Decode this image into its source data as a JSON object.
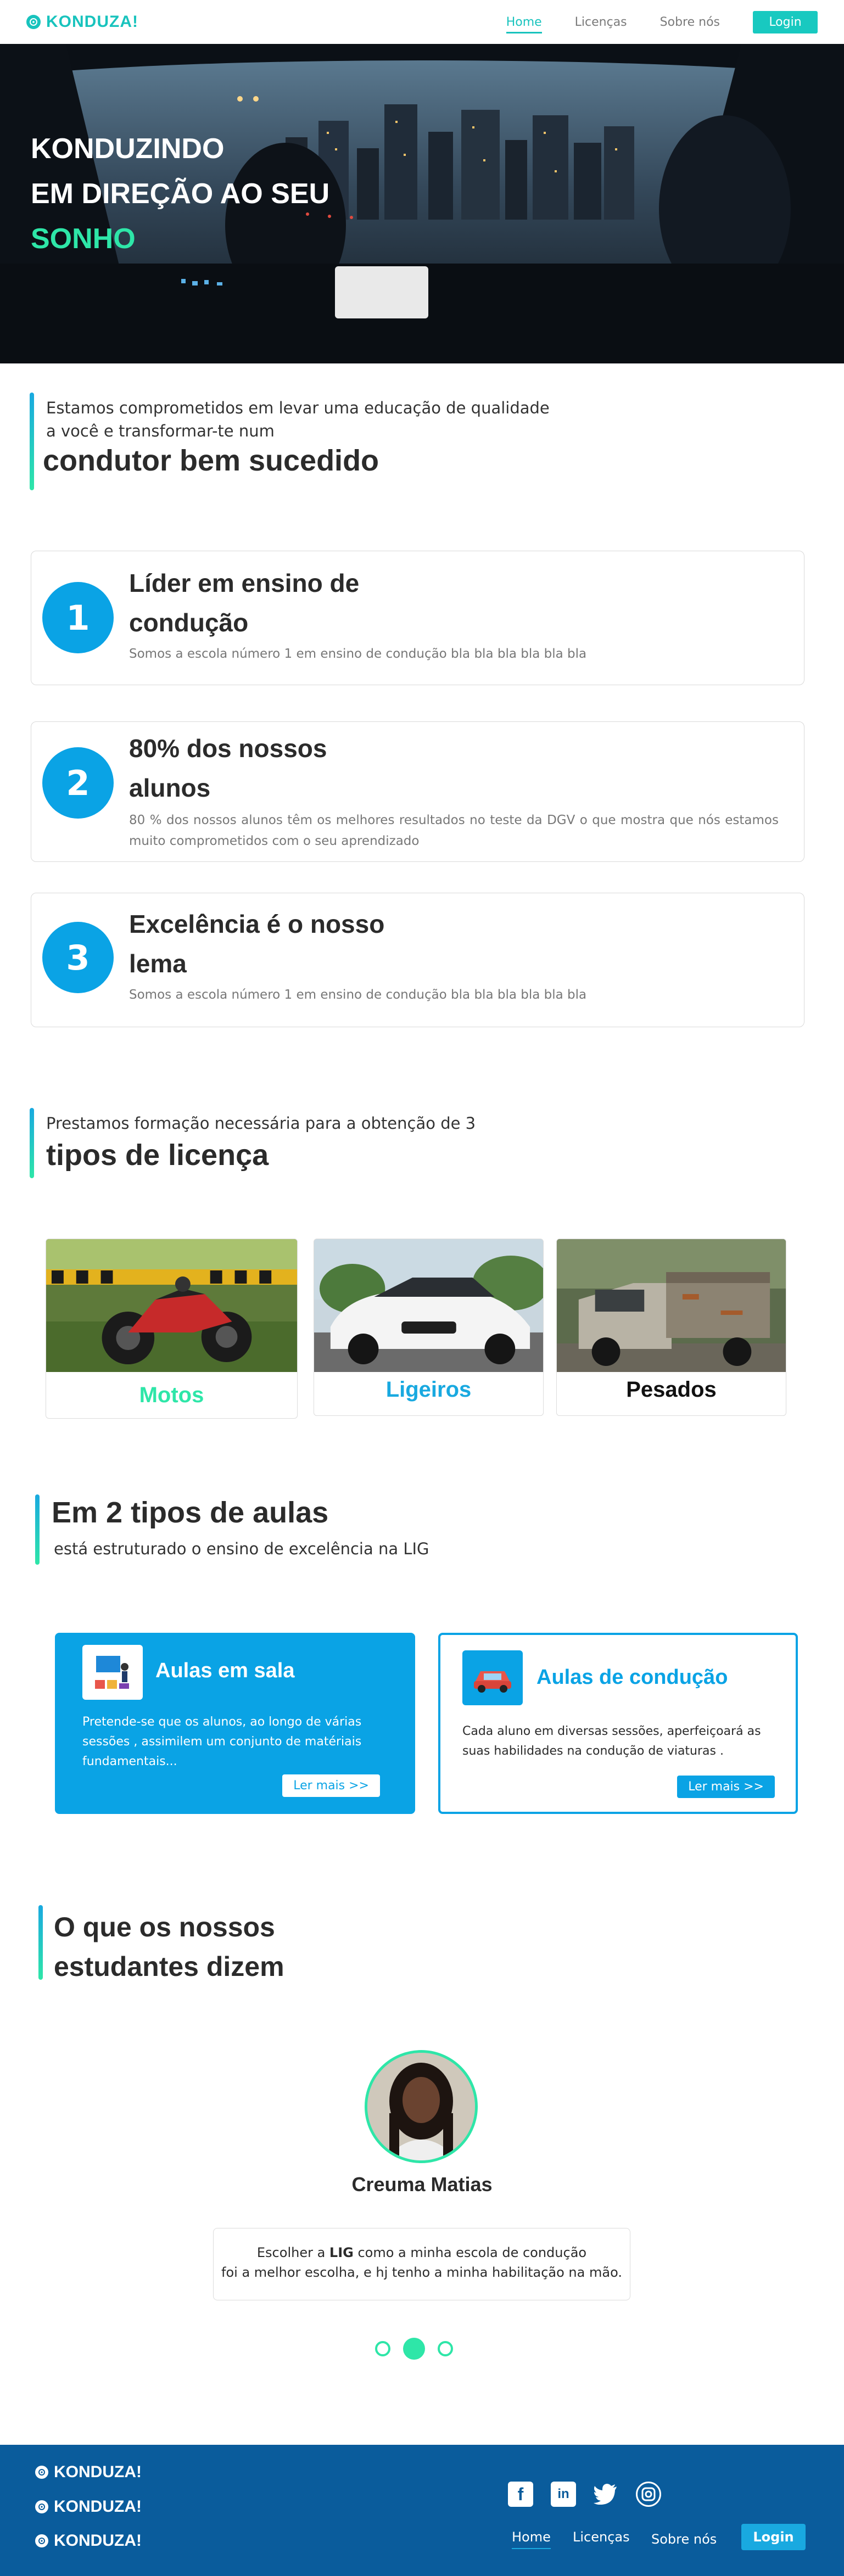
{
  "nav": {
    "brand": "KONDUZA!",
    "links": [
      "Home",
      "Licenças",
      "Sobre nós"
    ],
    "login": "Login"
  },
  "hero": {
    "line1": "KONDUZINDO",
    "line2": "EM DIREÇÃO AO SEU",
    "line3": "SONHO"
  },
  "intro": {
    "line1": "Estamos comprometidos em levar uma educação de qualidade",
    "line2": "a você e transformar-te num",
    "heading": "condutor bem sucedido"
  },
  "features": [
    {
      "number": "1",
      "title_line1": "Líder em ensino de",
      "title_line2": "condução",
      "description": "Somos a escola número 1 em ensino de condução bla bla bla bla bla bla"
    },
    {
      "number": "2",
      "title_line1": "80% dos nossos",
      "title_line2": "alunos",
      "description": "80 % dos nossos alunos têm os melhores resultados no teste da DGV o que mostra que nós estamos muito comprometidos com o seu aprendizado"
    },
    {
      "number": "3",
      "title_line1": "Excelência é o nosso",
      "title_line2": "lema",
      "description": "Somos a escola número 1 em ensino de condução bla bla bla bla bla bla"
    }
  ],
  "licenses_section": {
    "subtitle": "Prestamos formação necessária para a obtenção de 3",
    "heading": "tipos de licença",
    "cards": [
      {
        "label": "Motos",
        "color": "#2ee6a8"
      },
      {
        "label": "Ligeiros",
        "color": "#19a9e0"
      },
      {
        "label": "Pesados",
        "color": "#111111"
      }
    ]
  },
  "classes_section": {
    "heading": "Em 2 tipos de aulas",
    "subtitle": "está estruturado o ensino de excelência  na LIG",
    "cards": [
      {
        "title": "Aulas em sala",
        "description": "Pretende-se que os alunos, ao longo de várias sessões , assimilem um conjunto de matériais fundamentais...",
        "button": "Ler mais >>"
      },
      {
        "title": "Aulas de condução",
        "description": "Cada aluno em diversas sessões, aperfeiçoará as suas habilidades na condução de viaturas .",
        "button": "Ler mais >>"
      }
    ]
  },
  "testimonials": {
    "heading_line1": "O que os nossos",
    "heading_line2": "estudantes dizem",
    "name": "Creuma Matias",
    "quote_part1": "Escolher a ",
    "quote_bold": "LIG",
    "quote_part2": " como a minha escola de condução",
    "quote_line2": "foi a melhor escolha, e hj tenho a minha habilitação na mão.",
    "active_slide": 2,
    "slide_count": 3
  },
  "footer": {
    "brands": [
      "KONDUZA!",
      "KONDUZA!",
      "KONDUZA!"
    ],
    "links": [
      "Home",
      "Licenças",
      "Sobre nós"
    ],
    "login": "Login",
    "social": [
      "facebook-icon",
      "linkedin-icon",
      "twitter-icon",
      "instagram-icon"
    ]
  },
  "colors": {
    "teal": "#18c3bd",
    "green": "#2ee6a8",
    "blue": "#0aa3e5",
    "footer": "#0a5c9c"
  }
}
